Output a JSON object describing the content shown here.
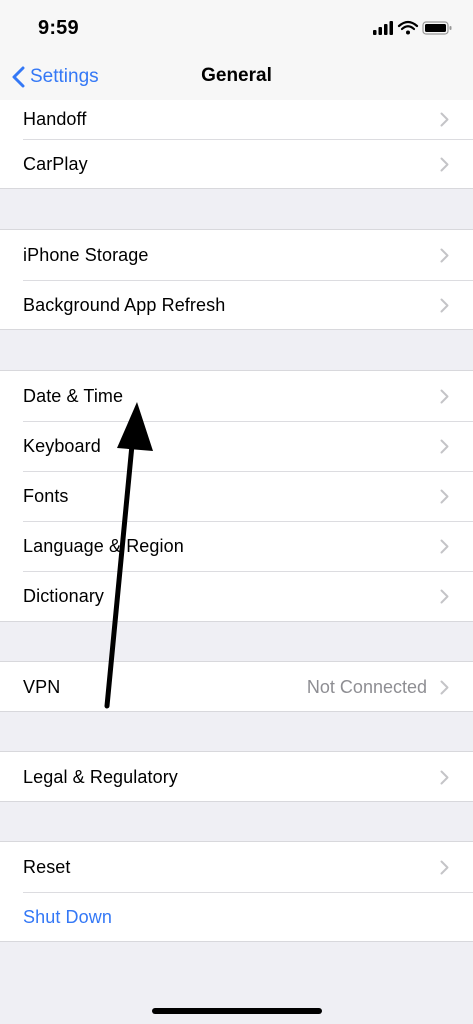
{
  "status_bar": {
    "time": "9:59",
    "icons": [
      "cellular-signal-icon",
      "wifi-icon",
      "battery-icon"
    ]
  },
  "nav": {
    "back_label": "Settings",
    "title": "General"
  },
  "groups": [
    {
      "rows": [
        {
          "label": "Handoff",
          "chevron": true
        },
        {
          "label": "CarPlay",
          "chevron": true
        }
      ]
    },
    {
      "rows": [
        {
          "label": "iPhone Storage",
          "chevron": true
        },
        {
          "label": "Background App Refresh",
          "chevron": true
        }
      ]
    },
    {
      "rows": [
        {
          "label": "Date & Time",
          "chevron": true
        },
        {
          "label": "Keyboard",
          "chevron": true
        },
        {
          "label": "Fonts",
          "chevron": true
        },
        {
          "label": "Language & Region",
          "chevron": true
        },
        {
          "label": "Dictionary",
          "chevron": true
        }
      ]
    },
    {
      "rows": [
        {
          "label": "VPN",
          "value": "Not Connected",
          "chevron": true
        }
      ]
    },
    {
      "rows": [
        {
          "label": "Legal & Regulatory",
          "chevron": true
        }
      ]
    },
    {
      "rows": [
        {
          "label": "Reset",
          "chevron": true
        },
        {
          "label": "Shut Down",
          "chevron": false
        }
      ]
    }
  ],
  "colors": {
    "accent": "#3478f6",
    "background": "#efeff4",
    "secondary_text": "#8e8e93",
    "chevron": "#c4c4c7"
  }
}
